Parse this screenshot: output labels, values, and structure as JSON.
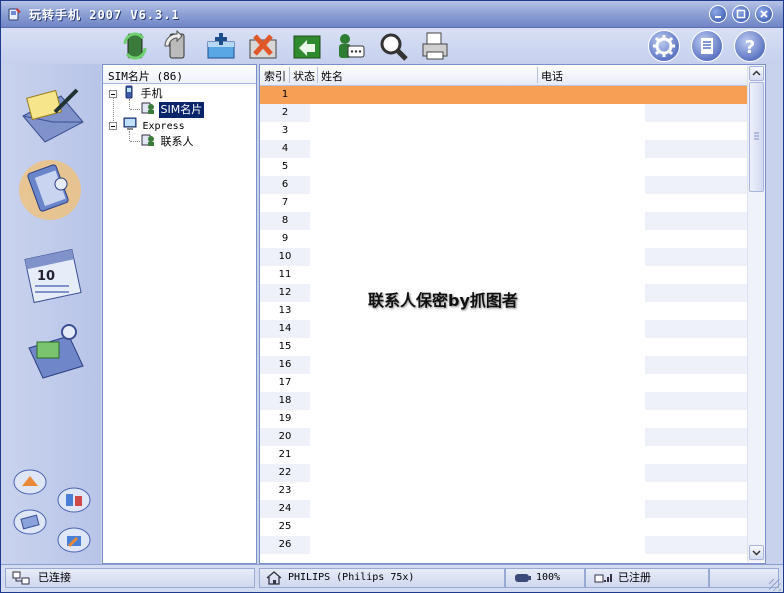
{
  "window": {
    "title": "玩转手机 2007 V6.3.1",
    "buttons": [
      "minimize",
      "maximize",
      "close"
    ]
  },
  "toolbar": {
    "buttons": [
      "sync-icon",
      "backup-icon",
      "add-icon",
      "delete-icon",
      "import-icon",
      "sms-icon",
      "search-icon",
      "print-icon"
    ],
    "right_buttons": [
      "settings-icon",
      "manual-icon",
      "help-icon"
    ]
  },
  "leftnav": {
    "items": [
      "messages-icon",
      "contacts-icon",
      "calendar-icon",
      "media-icon"
    ],
    "small_items": [
      "tool-1-icon",
      "tool-2-icon",
      "tool-3-icon",
      "tool-4-icon"
    ]
  },
  "tree": {
    "header": "SIM名片 (86)",
    "nodes": [
      {
        "label": "手机",
        "children": [
          {
            "label": "SIM名片",
            "selected": true
          }
        ]
      },
      {
        "label": "Express",
        "children": [
          {
            "label": "联系人",
            "selected": false
          }
        ]
      }
    ]
  },
  "list": {
    "columns": [
      "索引",
      "状态",
      "姓名",
      "电话"
    ],
    "rows": [
      "1",
      "2",
      "3",
      "4",
      "5",
      "6",
      "7",
      "8",
      "9",
      "10",
      "11",
      "12",
      "13",
      "14",
      "15",
      "16",
      "17",
      "18",
      "19",
      "20",
      "21",
      "22",
      "23",
      "24",
      "25",
      "26"
    ],
    "selected_row": "1",
    "watermark": "联系人保密by抓图者"
  },
  "status": {
    "connection": "已连接",
    "device": "PHILIPS (Philips 75x)",
    "battery": "100%",
    "registration": "已注册"
  },
  "colors": {
    "selected_row": "#f7a055",
    "band": "#eef1f9",
    "title_bar": "#8fa3d6"
  }
}
